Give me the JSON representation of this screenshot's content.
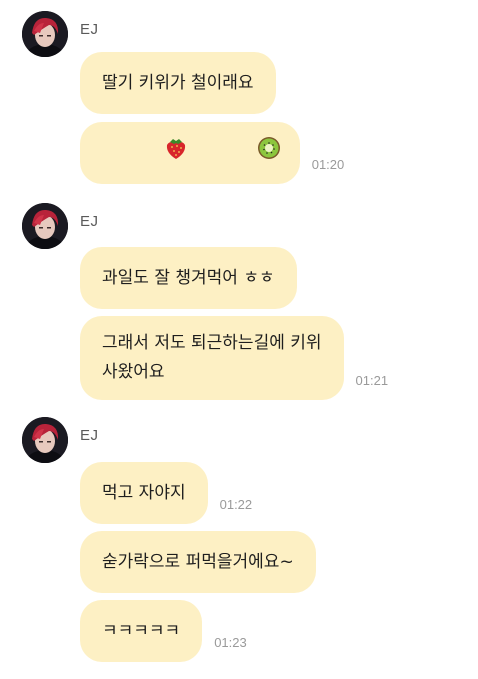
{
  "groups": [
    {
      "sender": "EJ",
      "messages": [
        {
          "text": "딸기 키위가 철이래요",
          "time": ""
        },
        {
          "text": "",
          "time": "01:20",
          "emoji": [
            "strawberry-icon",
            "kiwi-icon"
          ]
        }
      ]
    },
    {
      "sender": "EJ",
      "messages": [
        {
          "text": "과일도 잘 챙겨먹어 ㅎㅎ",
          "time": ""
        },
        {
          "text": "그래서 저도 퇴근하는길에 키위\n사왔어요",
          "time": "01:21"
        }
      ]
    },
    {
      "sender": "EJ",
      "messages": [
        {
          "text": "먹고 자야지",
          "time": "01:22"
        },
        {
          "text": "숟가락으로 퍼먹을거에요~",
          "time": ""
        },
        {
          "text": "ㅋㅋㅋㅋㅋ",
          "time": "01:23"
        }
      ]
    }
  ],
  "colors": {
    "bubble": "#fdf0c4",
    "time": "#9a9a9a",
    "sender": "#5a5a5a"
  }
}
